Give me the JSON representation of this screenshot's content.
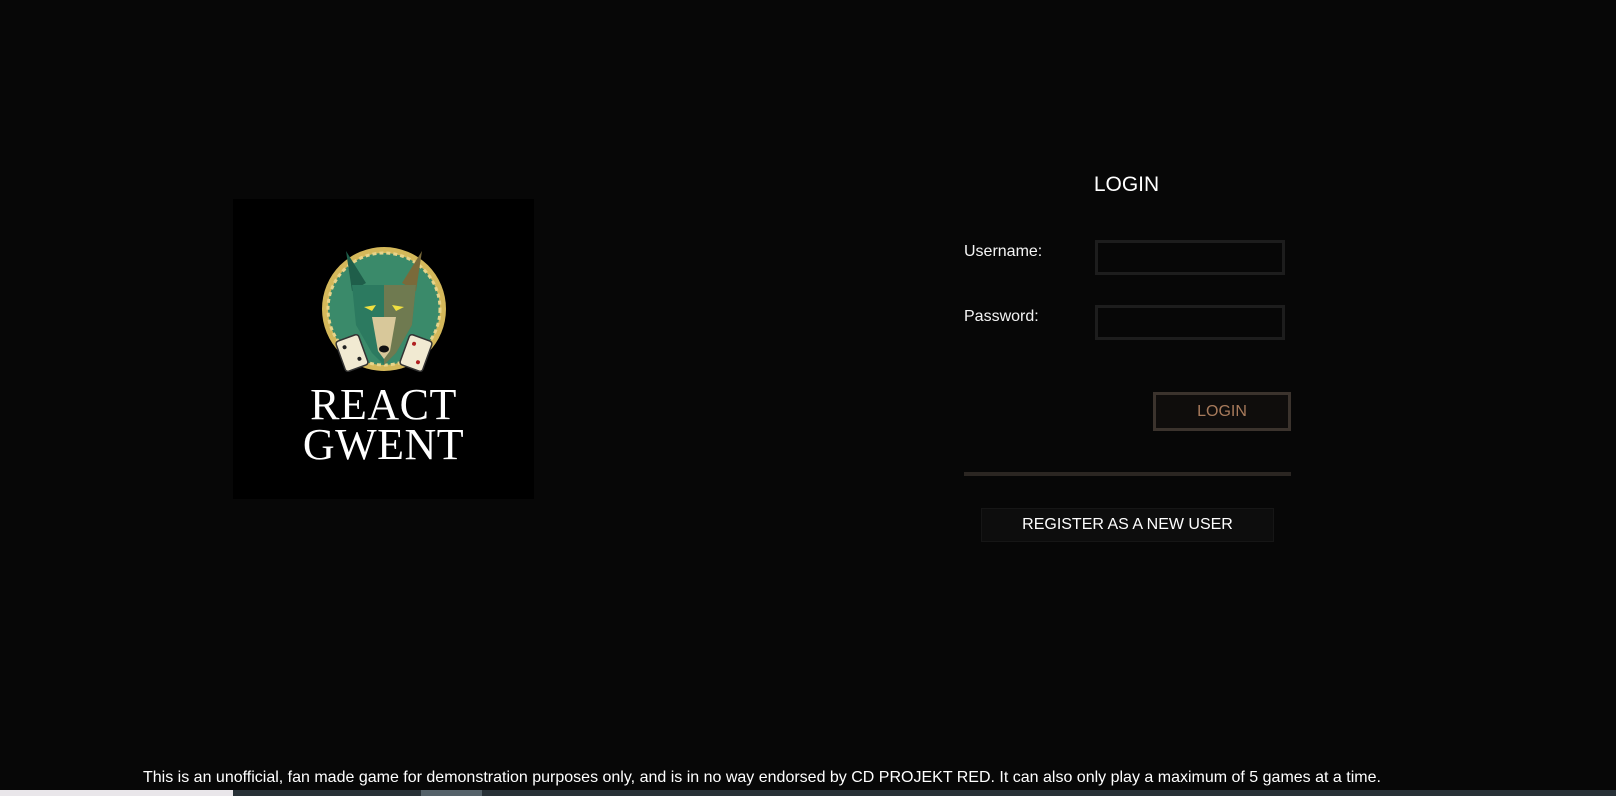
{
  "logo": {
    "emblem_icon": "wolf-emblem-icon",
    "line1": "REACT",
    "line2": "GWENT"
  },
  "login": {
    "title": "LOGIN",
    "username_label": "Username:",
    "username_value": "",
    "password_label": "Password:",
    "password_value": "",
    "button_label": "LOGIN",
    "register_label": "REGISTER AS A NEW USER"
  },
  "footer": {
    "disclaimer": "This is an unofficial, fan made game for demonstration purposes only, and is in no way endorsed by CD PROJEKT RED. It can also only play a maximum of 5 games at a time."
  },
  "colors": {
    "background": "#070707",
    "button_text": "#a77a5b",
    "button_border": "#3b332d",
    "divider": "#2b2622"
  }
}
